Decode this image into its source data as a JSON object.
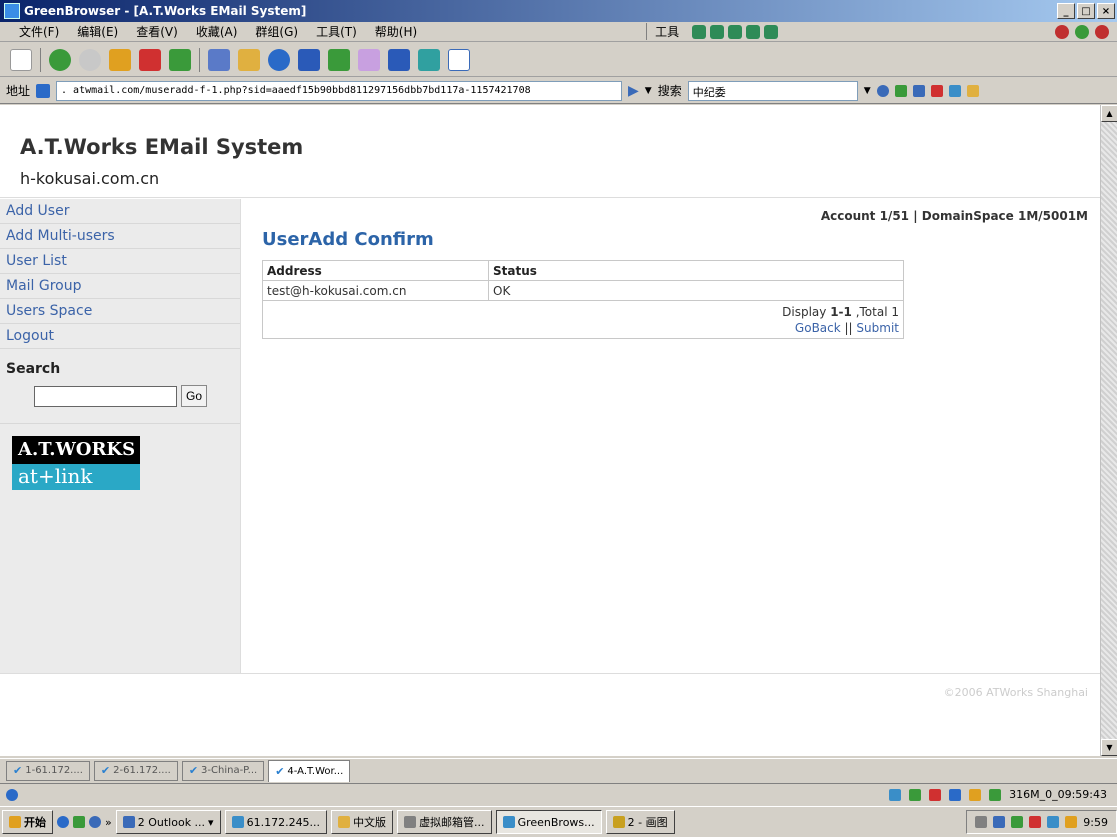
{
  "window": {
    "title": "GreenBrowser - [A.T.Works EMail System]",
    "min": "_",
    "max": "□",
    "close": "×"
  },
  "menu": [
    "文件(F)",
    "编辑(E)",
    "查看(V)",
    "收藏(A)",
    "群组(G)",
    "工具(T)",
    "帮助(H)"
  ],
  "menu_tools_label": "工具",
  "address": {
    "label": "地址",
    "url": ". atwmail.com/museradd-f-1.php?sid=aaedf15b90bbd811297156dbb7bd117a-1157421708",
    "search_label": "搜索",
    "search_value": "中纪委"
  },
  "page": {
    "site_title": "A.T.Works EMail System",
    "site_domain": "h-kokusai.com.cn",
    "account_info": "Account 1/51 | DomainSpace 1M/5001M",
    "main_title": "UserAdd Confirm",
    "footer": "©2006 ATWorks Shanghai"
  },
  "sidebar": {
    "items": [
      {
        "label": "Add User"
      },
      {
        "label": "Add Multi-users"
      },
      {
        "label": "User List"
      },
      {
        "label": "Mail Group"
      },
      {
        "label": "Users Space"
      },
      {
        "label": "Logout"
      }
    ],
    "search_title": "Search",
    "go_label": "Go",
    "logo_top": "A.T.WORKS",
    "logo_bottom": "at+link"
  },
  "table": {
    "headers": [
      "Address",
      "Status"
    ],
    "rows": [
      [
        "test@h-kokusai.com.cn",
        "OK"
      ]
    ],
    "display_prefix": "Display ",
    "display_range": "1-1",
    "display_suffix": " ,Total 1",
    "goback": "GoBack",
    "sep": " || ",
    "submit": "Submit"
  },
  "tabs": [
    {
      "label": "1-61.172...."
    },
    {
      "label": "2-61.172...."
    },
    {
      "label": "3-China-P..."
    },
    {
      "label": "4-A.T.Wor..."
    }
  ],
  "status_right": "316M_0_09:59:43",
  "taskbar": {
    "start": "开始",
    "items": [
      {
        "label": "2 Outlook ..."
      },
      {
        "label": "61.172.245..."
      },
      {
        "label": "中文版"
      },
      {
        "label": "虚拟邮箱管..."
      },
      {
        "label": "GreenBrows..."
      },
      {
        "label": "2 - 画图"
      }
    ],
    "clock": "9:59"
  },
  "colors": {
    "link": "#3b63a8",
    "title_blue": "#2c64a8",
    "logo_cyan": "#2aa8c6"
  }
}
